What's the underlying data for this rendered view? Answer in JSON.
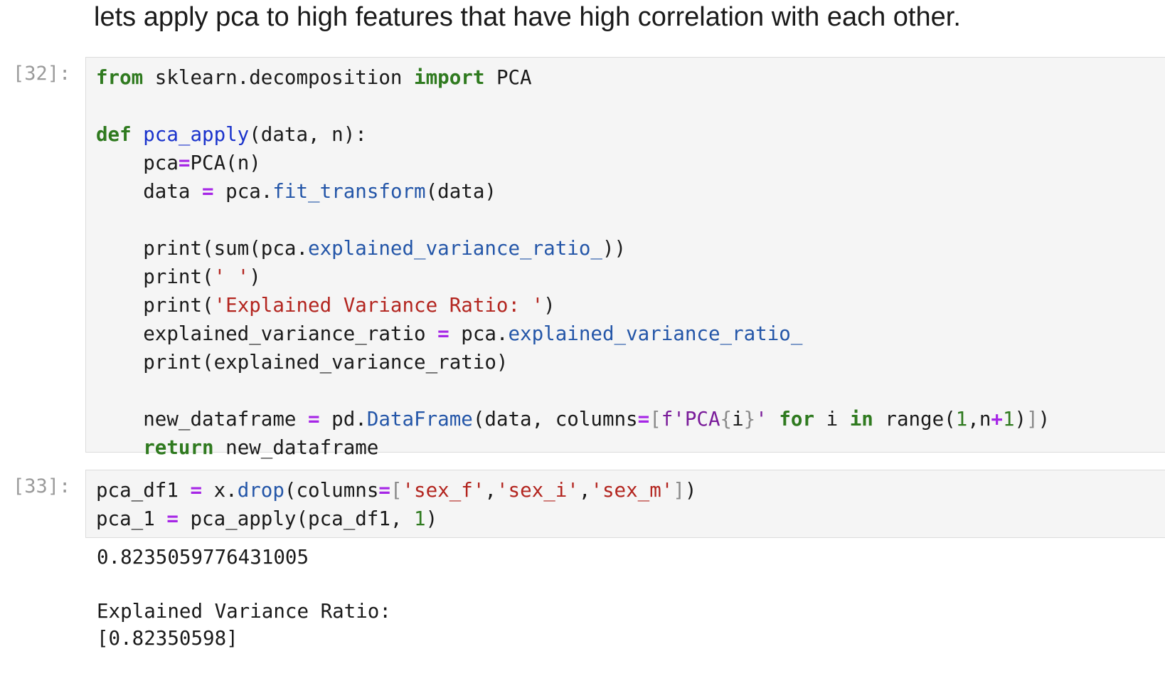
{
  "markdown": {
    "text": "lets apply pca to high features that have high correlation with each other."
  },
  "cells": [
    {
      "prompt": "[32]:",
      "lines": [
        [
          [
            "kw",
            "from"
          ],
          [
            "t",
            " sklearn.decomposition "
          ],
          [
            "kw",
            "import"
          ],
          [
            "t",
            " PCA"
          ]
        ],
        [],
        [
          [
            "kw",
            "def"
          ],
          [
            "t",
            " "
          ],
          [
            "fn",
            "pca_apply"
          ],
          [
            "t",
            "(data, n):"
          ]
        ],
        [
          [
            "t",
            "    pca"
          ],
          [
            "op",
            "="
          ],
          [
            "t",
            "PCA(n)"
          ]
        ],
        [
          [
            "t",
            "    data "
          ],
          [
            "op",
            "="
          ],
          [
            "t",
            " pca."
          ],
          [
            "attr",
            "fit_transform"
          ],
          [
            "t",
            "(data)"
          ]
        ],
        [],
        [
          [
            "t",
            "    print(sum(pca."
          ],
          [
            "attr",
            "explained_variance_ratio_"
          ],
          [
            "t",
            "))"
          ]
        ],
        [
          [
            "t",
            "    print("
          ],
          [
            "str",
            "' '"
          ],
          [
            "t",
            ")"
          ]
        ],
        [
          [
            "t",
            "    print("
          ],
          [
            "str",
            "'Explained Variance Ratio: '"
          ],
          [
            "t",
            ")"
          ]
        ],
        [
          [
            "t",
            "    explained_variance_ratio "
          ],
          [
            "op",
            "="
          ],
          [
            "t",
            " pca."
          ],
          [
            "attr",
            "explained_variance_ratio_"
          ]
        ],
        [
          [
            "t",
            "    print(explained_variance_ratio)"
          ]
        ],
        [],
        [
          [
            "t",
            "    new_dataframe "
          ],
          [
            "op",
            "="
          ],
          [
            "t",
            " pd."
          ],
          [
            "attr",
            "DataFrame"
          ],
          [
            "t",
            "(data, columns"
          ],
          [
            "op",
            "="
          ],
          [
            "brk",
            "["
          ],
          [
            "fstr",
            "f'PCA"
          ],
          [
            "brk",
            "{"
          ],
          [
            "t",
            "i"
          ],
          [
            "brk",
            "}"
          ],
          [
            "fstr",
            "'"
          ],
          [
            "t",
            " "
          ],
          [
            "kw",
            "for"
          ],
          [
            "t",
            " i "
          ],
          [
            "kw",
            "in"
          ],
          [
            "t",
            " range("
          ],
          [
            "num",
            "1"
          ],
          [
            "t",
            ",n"
          ],
          [
            "op",
            "+"
          ],
          [
            "num",
            "1"
          ],
          [
            "t",
            ")"
          ],
          [
            "brk",
            "]"
          ],
          [
            "t",
            ")"
          ]
        ],
        [
          [
            "t",
            "    "
          ],
          [
            "kw",
            "return"
          ],
          [
            "t",
            " new_dataframe"
          ]
        ]
      ]
    },
    {
      "prompt": "[33]:",
      "lines": [
        [
          [
            "t",
            "pca_df1 "
          ],
          [
            "op",
            "="
          ],
          [
            "t",
            " x."
          ],
          [
            "attr",
            "drop"
          ],
          [
            "t",
            "(columns"
          ],
          [
            "op",
            "="
          ],
          [
            "brk",
            "["
          ],
          [
            "str",
            "'sex_f'"
          ],
          [
            "t",
            ","
          ],
          [
            "str",
            "'sex_i'"
          ],
          [
            "t",
            ","
          ],
          [
            "str",
            "'sex_m'"
          ],
          [
            "brk",
            "]"
          ],
          [
            "t",
            ")"
          ]
        ],
        [
          [
            "t",
            "pca_1 "
          ],
          [
            "op",
            "="
          ],
          [
            "t",
            " pca_apply(pca_df1, "
          ],
          [
            "num",
            "1"
          ],
          [
            "t",
            ")"
          ]
        ]
      ],
      "output": [
        "0.8235059776431005",
        " ",
        "Explained Variance Ratio:",
        "[0.82350598]"
      ]
    }
  ]
}
